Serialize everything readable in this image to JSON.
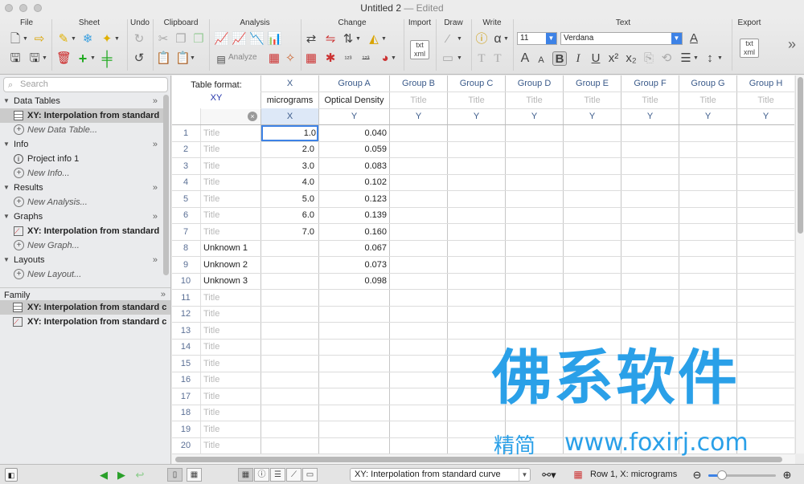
{
  "window": {
    "title": "Untitled 2",
    "edited": "— Edited"
  },
  "toolbar": {
    "groups": [
      "File",
      "Sheet",
      "Undo",
      "Clipboard",
      "Analysis",
      "Change",
      "Import",
      "Draw",
      "Write",
      "Text",
      "Export"
    ],
    "analyze_label": "Analyze",
    "font_size": "11",
    "font_name": "Verdana",
    "more": "»"
  },
  "sidebar": {
    "search_placeholder": "Search",
    "sections": [
      {
        "title": "Data Tables",
        "items": [
          "XY: Interpolation from standard"
        ],
        "new": "New Data Table..."
      },
      {
        "title": "Info",
        "items": [
          "Project info 1"
        ],
        "new": "New Info..."
      },
      {
        "title": "Results",
        "items": [],
        "new": "New Analysis..."
      },
      {
        "title": "Graphs",
        "items": [
          "XY: Interpolation from standard"
        ],
        "new": "New Graph..."
      },
      {
        "title": "Layouts",
        "items": [],
        "new": "New Layout..."
      }
    ],
    "family_title": "Family",
    "family_items": [
      "XY: Interpolation from standard c",
      "XY: Interpolation from standard c"
    ],
    "collapse": "»"
  },
  "table": {
    "format_label": "Table format:",
    "format_value": "XY",
    "x_col": {
      "header": "X",
      "title": "micrograms",
      "sub": "X"
    },
    "group_cols": [
      {
        "header": "Group A",
        "title": "Optical Density",
        "sub": "Y"
      },
      {
        "header": "Group B",
        "title": "Title",
        "sub": "Y"
      },
      {
        "header": "Group C",
        "title": "Title",
        "sub": "Y"
      },
      {
        "header": "Group D",
        "title": "Title",
        "sub": "Y"
      },
      {
        "header": "Group E",
        "title": "Title",
        "sub": "Y"
      },
      {
        "header": "Group F",
        "title": "Title",
        "sub": "Y"
      },
      {
        "header": "Group G",
        "title": "Title",
        "sub": "Y"
      },
      {
        "header": "Group H",
        "title": "Title",
        "sub": "Y"
      }
    ],
    "rows": [
      {
        "n": "1",
        "title": "Title",
        "x": "1.0",
        "y": "0.040"
      },
      {
        "n": "2",
        "title": "Title",
        "x": "2.0",
        "y": "0.059"
      },
      {
        "n": "3",
        "title": "Title",
        "x": "3.0",
        "y": "0.083"
      },
      {
        "n": "4",
        "title": "Title",
        "x": "4.0",
        "y": "0.102"
      },
      {
        "n": "5",
        "title": "Title",
        "x": "5.0",
        "y": "0.123"
      },
      {
        "n": "6",
        "title": "Title",
        "x": "6.0",
        "y": "0.139"
      },
      {
        "n": "7",
        "title": "Title",
        "x": "7.0",
        "y": "0.160"
      },
      {
        "n": "8",
        "title": "Unknown 1",
        "x": "",
        "y": "0.067"
      },
      {
        "n": "9",
        "title": "Unknown 2",
        "x": "",
        "y": "0.073"
      },
      {
        "n": "10",
        "title": "Unknown 3",
        "x": "",
        "y": "0.098"
      },
      {
        "n": "11",
        "title": "Title",
        "x": "",
        "y": ""
      },
      {
        "n": "12",
        "title": "Title",
        "x": "",
        "y": ""
      },
      {
        "n": "13",
        "title": "Title",
        "x": "",
        "y": ""
      },
      {
        "n": "14",
        "title": "Title",
        "x": "",
        "y": ""
      },
      {
        "n": "15",
        "title": "Title",
        "x": "",
        "y": ""
      },
      {
        "n": "16",
        "title": "Title",
        "x": "",
        "y": ""
      },
      {
        "n": "17",
        "title": "Title",
        "x": "",
        "y": ""
      },
      {
        "n": "18",
        "title": "Title",
        "x": "",
        "y": ""
      },
      {
        "n": "19",
        "title": "Title",
        "x": "",
        "y": ""
      },
      {
        "n": "20",
        "title": "Title",
        "x": "",
        "y": ""
      }
    ],
    "selected_cell": {
      "row": 1,
      "col": "X"
    }
  },
  "watermark": {
    "big": "佛系软件",
    "small1": "精简",
    "small2": "www.foxirj.com"
  },
  "status": {
    "sheet_select": "XY: Interpolation from standard curve",
    "position": "Row 1, X: micrograms",
    "zoom_level": 0.2
  },
  "colors": {
    "accent": "#3d82e6",
    "header_blue": "#3a5a8a",
    "selection": "#cbcbcb",
    "watermark": "#2aa0e8"
  }
}
